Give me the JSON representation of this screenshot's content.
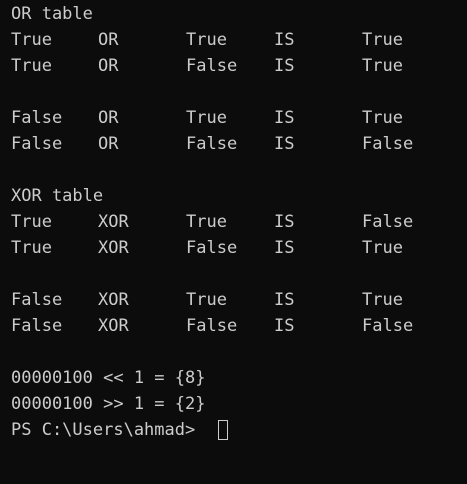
{
  "terminal": {
    "or_title": "OR table",
    "or_rows": [
      [
        "True",
        "OR",
        "True",
        "IS",
        "True"
      ],
      [
        "True",
        "OR",
        "False",
        "IS",
        "True"
      ],
      [
        "False",
        "OR",
        "True",
        "IS",
        "True"
      ],
      [
        "False",
        "OR",
        "False",
        "IS",
        "False"
      ]
    ],
    "xor_title": "XOR table",
    "xor_rows": [
      [
        "True",
        "XOR",
        "True",
        "IS",
        "False"
      ],
      [
        "True",
        "XOR",
        "False",
        "IS",
        "True"
      ],
      [
        "False",
        "XOR",
        "True",
        "IS",
        "True"
      ],
      [
        "False",
        "XOR",
        "False",
        "IS",
        "False"
      ]
    ],
    "shift_left_line": "00000100 << 1 = {8}",
    "shift_right_line": "00000100 >> 1 = {2}",
    "prompt": "PS C:\\Users\\ahmad>"
  }
}
